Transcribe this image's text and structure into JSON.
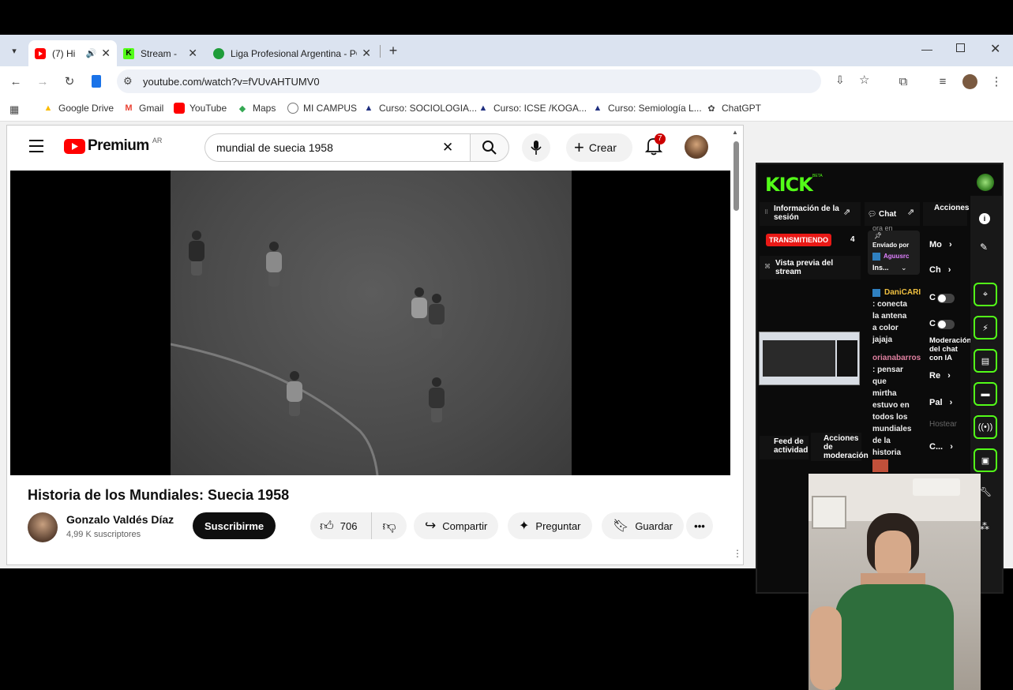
{
  "tabs": [
    {
      "label": "(7) Hi",
      "favicon": "youtube-icon",
      "active": true
    },
    {
      "label": "Stream - ",
      "favicon": "kick-icon",
      "active": false
    },
    {
      "label": "Liga Profesional Argentina - PC",
      "favicon": "globe-icon",
      "active": false
    }
  ],
  "address_bar": {
    "url": "youtube.com/watch?v=fVUvAHTUMV0"
  },
  "bookmarks": [
    {
      "label": "Google Drive",
      "icon": "google-drive-icon"
    },
    {
      "label": "Gmail",
      "icon": "gmail-icon"
    },
    {
      "label": "YouTube",
      "icon": "youtube-icon"
    },
    {
      "label": "Maps",
      "icon": "maps-icon"
    },
    {
      "label": "MI CAMPUS",
      "icon": "campus-icon"
    },
    {
      "label": "Curso: SOCIOLOGIA...",
      "icon": "course-icon"
    },
    {
      "label": "Curso: ICSE /KOGA...",
      "icon": "course-icon"
    },
    {
      "label": "Curso: Semiología L...",
      "icon": "course-icon"
    },
    {
      "label": "ChatGPT",
      "icon": "chatgpt-icon"
    }
  ],
  "youtube": {
    "logo_text": "Premium",
    "region": "AR",
    "search_value": "mundial de suecia 1958",
    "create_label": "Crear",
    "notification_count": "7",
    "video_title": "Historia de los Mundiales: Suecia 1958",
    "channel_name": "Gonzalo Valdés Díaz",
    "subscribers": "4,99 K suscriptores",
    "subscribe_label": "Suscribirme",
    "likes": "706",
    "share_label": "Compartir",
    "ask_label": "Preguntar",
    "save_label": "Guardar"
  },
  "kick": {
    "logo": "KICK",
    "logo_sup": "BETA",
    "session_info": "Información de la sesión",
    "live_badge": "TRANSMITIENDO",
    "live_count": "4",
    "stream_preview": "Vista previa del stream",
    "chat_label": "Chat",
    "chat_fragment": "ora en",
    "pinned_by": "Enviado por",
    "pinned_user": "Aguusrc",
    "pinned_msg": "Ins...",
    "messages": [
      {
        "user": "DaniCARI",
        "lines": [
          ": conecta",
          "la antena",
          "a color",
          "jajaja"
        ],
        "color": "#f0c040"
      },
      {
        "user": "orianabarros",
        "lines": [
          ": pensar",
          "que",
          "mirtha",
          "estuvo en",
          "todos los",
          "mundiales",
          "de la",
          "historia"
        ],
        "color": "#e080a0"
      }
    ],
    "actions_label": "Acciones de canal",
    "actions_items": [
      "Mo",
      "Ch",
      "C",
      "C"
    ],
    "ai_mod": "Moderación del chat con IA",
    "ai_items": [
      "Re",
      "Pal",
      "Hostear",
      "C..."
    ],
    "activity_feed": "Feed de actividad",
    "mod_actions": "Acciones de moderación"
  },
  "colors": {
    "kick_green": "#53fc18",
    "yt_red": "#ff0000",
    "live_red": "#e91916"
  }
}
